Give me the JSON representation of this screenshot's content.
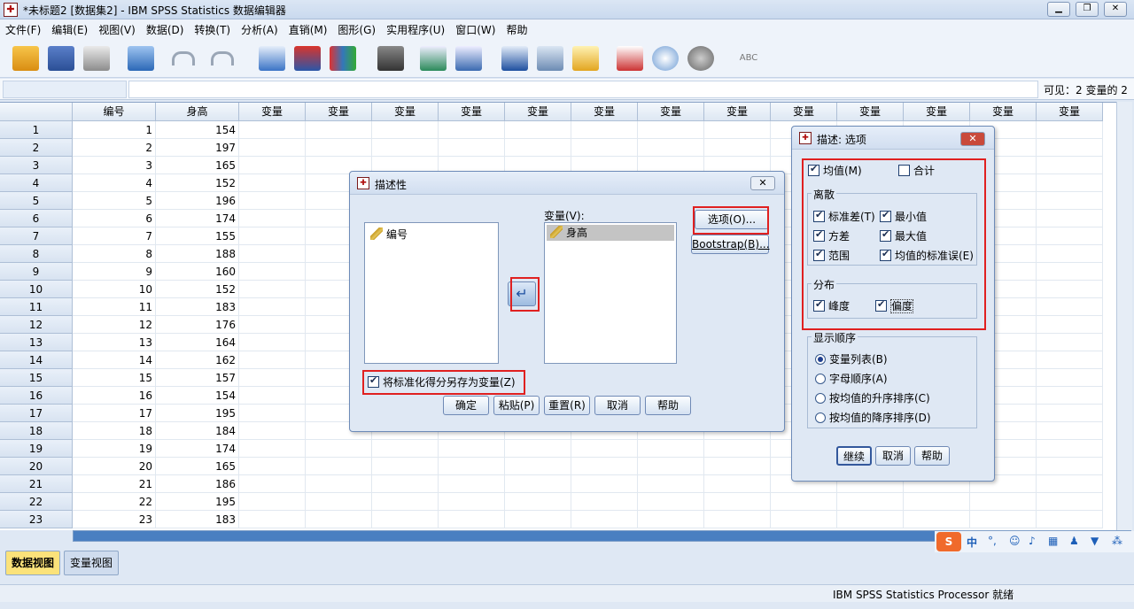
{
  "window": {
    "title": "*未标题2 [数据集2] - IBM SPSS Statistics 数据编辑器",
    "min": "▁",
    "max": "❐",
    "close": "✕"
  },
  "menu": [
    "文件(F)",
    "编辑(E)",
    "视图(V)",
    "数据(D)",
    "转换(T)",
    "分析(A)",
    "直销(M)",
    "图形(G)",
    "实用程序(U)",
    "窗口(W)",
    "帮助"
  ],
  "toolbar_icons": [
    "open-icon",
    "save-icon",
    "print-icon",
    "recall-dialog-icon",
    "undo-icon",
    "redo-icon",
    "goto-case-icon",
    "goto-variable-icon",
    "variables-icon",
    "find-icon",
    "insert-case-icon",
    "insert-variable-icon",
    "split-file-icon",
    "weight-cases-icon",
    "select-cases-icon",
    "value-labels-icon",
    "use-sets-icon",
    "show-all-icon",
    "spell-check-icon"
  ],
  "cellbar": {
    "ref": "",
    "value": "",
    "visible": "可见：2 变量的 2"
  },
  "grid": {
    "columns": [
      "编号",
      "身高",
      "变量",
      "变量",
      "变量",
      "变量",
      "变量",
      "变量",
      "变量",
      "变量",
      "变量",
      "变量",
      "变量",
      "变量",
      "变量"
    ],
    "rows": [
      [
        "1",
        "1",
        "154"
      ],
      [
        "2",
        "2",
        "197"
      ],
      [
        "3",
        "3",
        "165"
      ],
      [
        "4",
        "4",
        "152"
      ],
      [
        "5",
        "5",
        "196"
      ],
      [
        "6",
        "6",
        "174"
      ],
      [
        "7",
        "7",
        "155"
      ],
      [
        "8",
        "8",
        "188"
      ],
      [
        "9",
        "9",
        "160"
      ],
      [
        "10",
        "10",
        "152"
      ],
      [
        "11",
        "11",
        "183"
      ],
      [
        "12",
        "12",
        "176"
      ],
      [
        "13",
        "13",
        "164"
      ],
      [
        "14",
        "14",
        "162"
      ],
      [
        "15",
        "15",
        "157"
      ],
      [
        "16",
        "16",
        "154"
      ],
      [
        "17",
        "17",
        "195"
      ],
      [
        "18",
        "18",
        "184"
      ],
      [
        "19",
        "19",
        "174"
      ],
      [
        "20",
        "20",
        "165"
      ],
      [
        "21",
        "21",
        "186"
      ],
      [
        "22",
        "22",
        "195"
      ],
      [
        "23",
        "23",
        "183"
      ]
    ]
  },
  "tabs": {
    "data_view": "数据视图",
    "variable_view": "变量视图"
  },
  "status": {
    "text": "IBM SPSS Statistics Processor 就绪"
  },
  "descriptives": {
    "title": "描述性",
    "source_items": [
      "编号"
    ],
    "variables_label": "变量(V):",
    "target_items": [
      "身高"
    ],
    "options_button": "选项(O)...",
    "bootstrap_button": "Bootstrap(B)...",
    "save_standardized": "将标准化得分另存为变量(Z)",
    "buttons": {
      "ok": "确定",
      "paste": "粘贴(P)",
      "reset": "重置(R)",
      "cancel": "取消",
      "help": "帮助"
    }
  },
  "options_dialog": {
    "title": "描述: 选项",
    "mean": "均值(M)",
    "sum": "合计",
    "dispersion_label": "离散",
    "dispersion": {
      "std": "标准差(T)",
      "min": "最小值",
      "variance": "方差",
      "max": "最大值",
      "range": "范围",
      "se_mean": "均值的标准误(E)"
    },
    "distribution_label": "分布",
    "distribution": {
      "kurtosis": "峰度",
      "skewness": "偏度"
    },
    "order_label": "显示顺序",
    "order": [
      "变量列表(B)",
      "字母顺序(A)",
      "按均值的升序排序(C)",
      "按均值的降序排序(D)"
    ],
    "buttons": {
      "continue": "继续",
      "cancel": "取消",
      "help": "帮助"
    }
  },
  "ime": {
    "logo": "S",
    "lang": "中"
  }
}
